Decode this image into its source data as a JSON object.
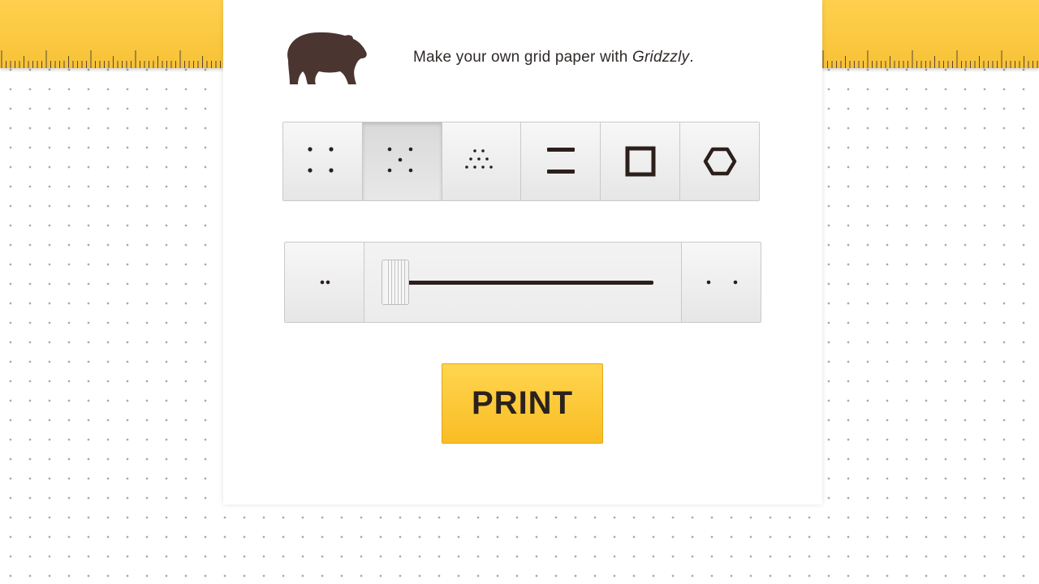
{
  "tagline": {
    "prefix": "Make your own grid paper with ",
    "brand": "Gridzzly",
    "suffix": "."
  },
  "logo": {
    "icon": "bear-icon",
    "color": "#4a3531"
  },
  "patterns": [
    {
      "name": "large-dots",
      "icon": "dots-large-icon",
      "selected": false
    },
    {
      "name": "dots-x",
      "icon": "dots-x-icon",
      "selected": true
    },
    {
      "name": "dots-dense",
      "icon": "dots-dense-icon",
      "selected": false
    },
    {
      "name": "lines",
      "icon": "lines-icon",
      "selected": false
    },
    {
      "name": "squares",
      "icon": "square-icon",
      "selected": false
    },
    {
      "name": "hexagons",
      "icon": "hexagon-icon",
      "selected": false
    }
  ],
  "spacing": {
    "decrease_icon": "dots-narrow-icon",
    "increase_icon": "dots-wide-icon",
    "slider_value": 0.0
  },
  "print_button": {
    "label": "PRINT"
  },
  "colors": {
    "accent": "#f9c22e",
    "ink": "#2b1f1c",
    "ruler": "#fcc83f"
  }
}
